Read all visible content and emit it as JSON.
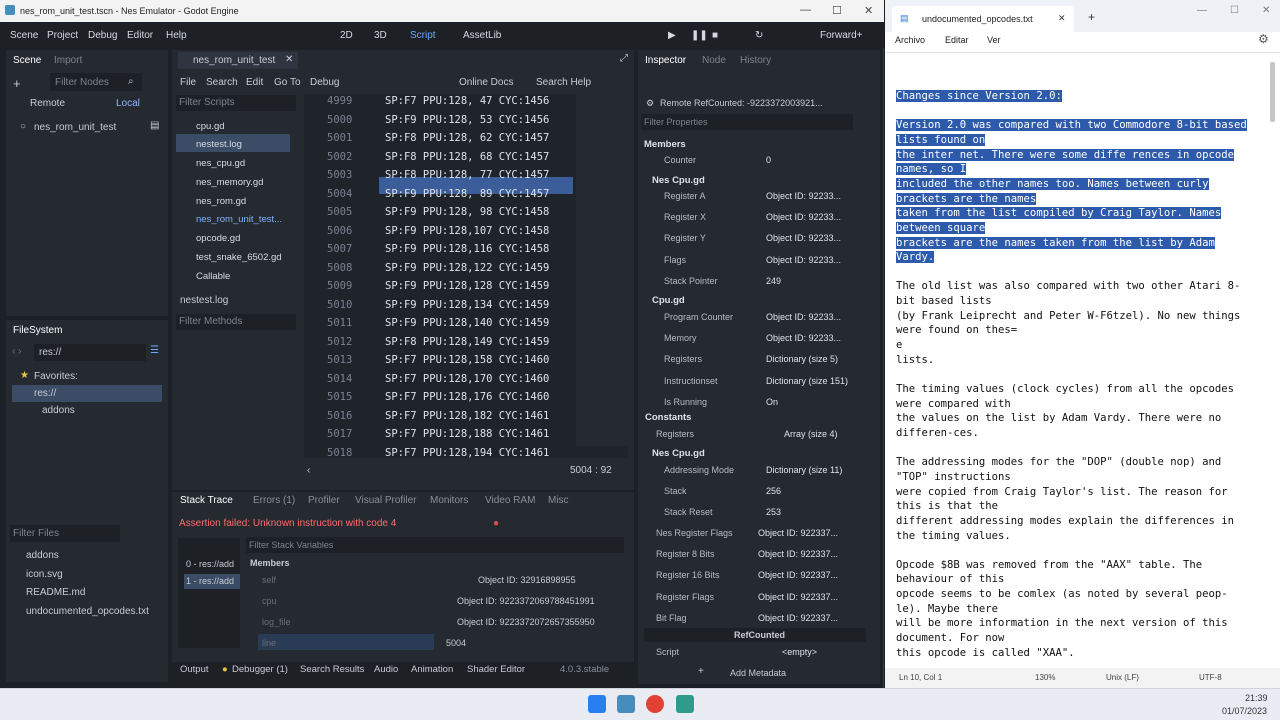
{
  "godot": {
    "title": "nes_rom_unit_test.tscn - Nes Emulator - Godot Engine",
    "menu": [
      "Scene",
      "Project",
      "Debug",
      "Editor",
      "Help"
    ],
    "workspaces": [
      "2D",
      "3D",
      "Script",
      "AssetLib"
    ],
    "renderer": "Forward+",
    "scene_tabs": [
      "Scene",
      "Import"
    ],
    "filter_nodes_placeholder": "Filter Nodes",
    "remote_label": "Remote",
    "local_label": "Local",
    "scene_root": "nes_rom_unit_test",
    "filesystem_tab": "FileSystem",
    "fs_path": "res://",
    "fs_favorites": "Favorites:",
    "fs_res": "res://",
    "fs_addons": "addons",
    "filter_files_placeholder": "Filter Files",
    "files": [
      "addons",
      "icon.svg",
      "README.md",
      "undocumented_opcodes.txt"
    ],
    "script_menu": [
      "File",
      "Search",
      "Edit",
      "Go To",
      "Debug"
    ],
    "online_docs": "Online Docs",
    "search_help": "Search Help",
    "open_tab": "nes_rom_unit_test",
    "filter_scripts_placeholder": "Filter Scripts",
    "scripts": [
      "cpu.gd",
      "nestest.log",
      "nes_cpu.gd",
      "nes_memory.gd",
      "nes_rom.gd",
      "nes_rom_unit_test...",
      "opcode.gd",
      "test_snake_6502.gd",
      "Callable"
    ],
    "current_script": "nestest.log",
    "filter_methods_placeholder": "Filter Methods",
    "code_lines": [
      {
        "n": "4999",
        "t": "SP:F7 PPU:128, 47 CYC:1456"
      },
      {
        "n": "5000",
        "t": "SP:F9 PPU:128, 53 CYC:1456"
      },
      {
        "n": "5001",
        "t": "SP:F8 PPU:128, 62 CYC:1457"
      },
      {
        "n": "5002",
        "t": "SP:F8 PPU:128, 68 CYC:1457"
      },
      {
        "n": "5003",
        "t": "SP:F8 PPU:128, 77 CYC:1457"
      },
      {
        "n": "5004",
        "t": "SP:F9 PPU:128, 89 CYC:1457"
      },
      {
        "n": "5005",
        "t": "SP:F9 PPU:128, 98 CYC:1458"
      },
      {
        "n": "5006",
        "t": "SP:F9 PPU:128,107 CYC:1458"
      },
      {
        "n": "5007",
        "t": "SP:F9 PPU:128,116 CYC:1458"
      },
      {
        "n": "5008",
        "t": "SP:F9 PPU:128,122 CYC:1459"
      },
      {
        "n": "5009",
        "t": "SP:F9 PPU:128,128 CYC:1459"
      },
      {
        "n": "5010",
        "t": "SP:F9 PPU:128,134 CYC:1459"
      },
      {
        "n": "5011",
        "t": "SP:F9 PPU:128,140 CYC:1459"
      },
      {
        "n": "5012",
        "t": "SP:F8 PPU:128,149 CYC:1459"
      },
      {
        "n": "5013",
        "t": "SP:F7 PPU:128,158 CYC:1460"
      },
      {
        "n": "5014",
        "t": "SP:F7 PPU:128,170 CYC:1460"
      },
      {
        "n": "5015",
        "t": "SP:F7 PPU:128,176 CYC:1460"
      },
      {
        "n": "5016",
        "t": "SP:F7 PPU:128,182 CYC:1461"
      },
      {
        "n": "5017",
        "t": "SP:F7 PPU:128,188 CYC:1461"
      },
      {
        "n": "5018",
        "t": "SP:F7 PPU:128,194 CYC:1461"
      }
    ],
    "cursor_pos": "5004 :  92",
    "debug_tabs": [
      "Stack Trace",
      "Errors (1)",
      "Profiler",
      "Visual Profiler",
      "Monitors",
      "Video RAM",
      "Misc"
    ],
    "error_msg": "Assertion failed: Unknown instruction with code 4",
    "stack_frames": [
      "0 - res://add",
      "1 - res://add"
    ],
    "filter_stack_placeholder": "Filter Stack Variables",
    "members_label": "Members",
    "stack_vars": [
      {
        "k": "self",
        "v": "Object ID: 32916898955"
      },
      {
        "k": "cpu",
        "v": "Object ID: 9223372069788451991"
      },
      {
        "k": "log_file",
        "v": "Object ID: 9223372072657355950"
      },
      {
        "k": "line",
        "v": "5004"
      }
    ],
    "bottom_tabs": [
      "Output",
      "Debugger (1)",
      "Search Results",
      "Audio",
      "Animation",
      "Shader Editor"
    ],
    "version": "4.0.3.stable",
    "inspector_tabs": [
      "Inspector",
      "Node",
      "History"
    ],
    "remote_obj": "Remote RefCounted: -9223372003921...",
    "filter_props_placeholder": "Filter Properties",
    "inspector": {
      "members": "Members",
      "counter_k": "Counter",
      "counter_v": "0",
      "sec1": "Nes Cpu.gd",
      "rows1": [
        {
          "k": "Register A",
          "v": "Object ID: 92233..."
        },
        {
          "k": "Register X",
          "v": "Object ID: 92233..."
        },
        {
          "k": "Register Y",
          "v": "Object ID: 92233..."
        },
        {
          "k": "Flags",
          "v": "Object ID: 92233..."
        },
        {
          "k": "Stack Pointer",
          "v": "249"
        }
      ],
      "sec2": "Cpu.gd",
      "rows2": [
        {
          "k": "Program Counter",
          "v": "Object ID: 92233..."
        },
        {
          "k": "Memory",
          "v": "Object ID: 92233..."
        },
        {
          "k": "Registers",
          "v": "Dictionary (size 5)"
        },
        {
          "k": "Instructionset",
          "v": "Dictionary (size 151)"
        },
        {
          "k": "Is Running",
          "v": "On"
        }
      ],
      "constants": "Constants",
      "const_registers_k": "Registers",
      "const_registers_v": "Array (size 4)",
      "sec3": "Nes Cpu.gd",
      "rows3": [
        {
          "k": "Addressing Mode",
          "v": "Dictionary (size 11)"
        },
        {
          "k": "Stack",
          "v": "256"
        },
        {
          "k": "Stack Reset",
          "v": "253"
        }
      ],
      "rows4": [
        {
          "k": "Nes Register Flags",
          "v": "Object ID: 922337..."
        },
        {
          "k": "Register 8 Bits",
          "v": "Object ID: 922337..."
        },
        {
          "k": "Register 16 Bits",
          "v": "Object ID: 922337..."
        },
        {
          "k": "Register Flags",
          "v": "Object ID: 922337..."
        },
        {
          "k": "Bit Flag",
          "v": "Object ID: 922337..."
        }
      ],
      "refcounted": "RefCounted",
      "script_k": "Script",
      "script_v": "<empty>",
      "add_metadata": "Add Metadata"
    }
  },
  "notepad": {
    "tab_title": "undocumented_opcodes.txt",
    "menu": [
      "Archivo",
      "Editar",
      "Ver"
    ],
    "lines": [
      {
        "t": "Changes since Version 2.0:",
        "h": true
      },
      {
        "t": "",
        "h": false
      },
      {
        "t": "Version 2.0 was compared with two Commodore 8-bit based",
        "h": true
      },
      {
        "t": "lists found on",
        "h": true
      },
      {
        "t": "the inter net. There were some diffe rences in opcode",
        "h": true
      },
      {
        "t": "names, so I",
        "h": true
      },
      {
        "t": "included the other names too. Names between curly",
        "h": true
      },
      {
        "t": "brackets are the names",
        "h": true
      },
      {
        "t": "taken from the list compiled by Craig Taylor. Names",
        "h": true
      },
      {
        "t": "between square",
        "h": true
      },
      {
        "t": "brackets are the names taken from the list by Adam",
        "h": true
      },
      {
        "t": "Vardy.",
        "h": true
      },
      {
        "t": "",
        "h": false
      },
      {
        "t": "The old list was also compared with two other Atari 8-",
        "h": false
      },
      {
        "t": "bit based lists",
        "h": false
      },
      {
        "t": "(by Frank Leiprecht and Peter W-F6tzel). No new things",
        "h": false
      },
      {
        "t": "were found on thes=",
        "h": false
      },
      {
        "t": "e",
        "h": false
      },
      {
        "t": "lists.",
        "h": false
      },
      {
        "t": "",
        "h": false
      },
      {
        "t": "The timing values (clock cycles) from all the opcodes",
        "h": false
      },
      {
        "t": "were compared with",
        "h": false
      },
      {
        "t": "the values on the list by Adam Vardy. There were no",
        "h": false
      },
      {
        "t": "differen-ces.",
        "h": false
      },
      {
        "t": "",
        "h": false
      },
      {
        "t": "The addressing modes for the \"DOP\" (double nop) and",
        "h": false
      },
      {
        "t": "\"TOP\" instructions",
        "h": false
      },
      {
        "t": "were copied from Craig Taylor's list. The reason for",
        "h": false
      },
      {
        "t": "this is that the",
        "h": false
      },
      {
        "t": "different addressing modes explain the differences in",
        "h": false
      },
      {
        "t": "the timing values.",
        "h": false
      },
      {
        "t": "",
        "h": false
      },
      {
        "t": "Opcode $8B was removed from the \"AAX\" table. The",
        "h": false
      },
      {
        "t": "behaviour of this",
        "h": false
      },
      {
        "t": "opcode seems to be comlex (as noted by several peop-",
        "h": false
      },
      {
        "t": "le). Maybe there",
        "h": false
      },
      {
        "t": "will be more information in the next version of this",
        "h": false
      },
      {
        "t": "document. For now",
        "h": false
      },
      {
        "t": "this opcode is called \"XAA\".",
        "h": false
      }
    ],
    "status": [
      "Ln 10, Col 1",
      "130%",
      "Unix (LF)",
      "UTF-8"
    ]
  },
  "taskbar": {
    "time": "21:39",
    "date": "01/07/2023"
  },
  "colors": {
    "accent": "#4a8fe7",
    "error": "#ff6b6b",
    "selection": "#2e5aab"
  }
}
